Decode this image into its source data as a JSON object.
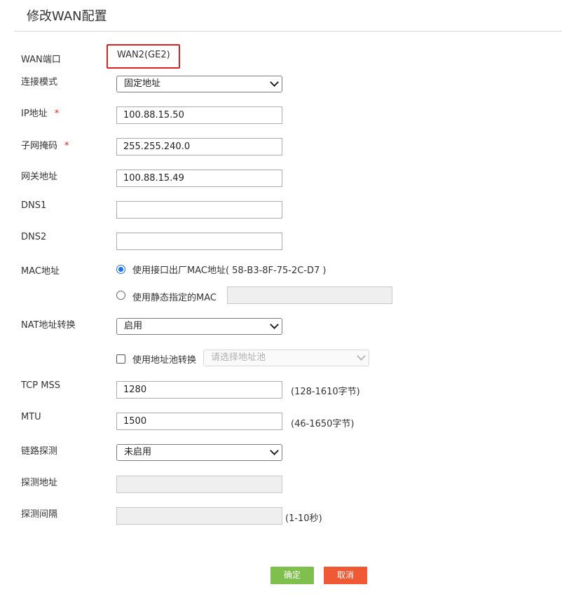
{
  "page": {
    "title": "修改WAN配置"
  },
  "wan_port": {
    "label": "WAN端口",
    "value": "WAN2(GE2)"
  },
  "connect_mode": {
    "label": "连接模式",
    "value": "固定地址"
  },
  "ip": {
    "label": "IP地址",
    "required": "*",
    "value": "100.88.15.50"
  },
  "mask": {
    "label": "子网掩码",
    "required": "*",
    "value": "255.255.240.0"
  },
  "gateway": {
    "label": "网关地址",
    "value": "100.88.15.49"
  },
  "dns1": {
    "label": "DNS1",
    "value": ""
  },
  "dns2": {
    "label": "DNS2",
    "value": ""
  },
  "mac": {
    "label": "MAC地址",
    "option_iface": "使用接口出厂MAC地址( 58-B3-8F-75-2C-D7 )",
    "option_static": "使用静态指定的MAC",
    "selected": "option_iface",
    "static_value": ""
  },
  "nat": {
    "label": "NAT地址转换",
    "value": "启用",
    "pool_checkbox_label": "使用地址池转换",
    "pool_checked": false,
    "pool_placeholder": "请选择地址池"
  },
  "tcp_mss": {
    "label": "TCP MSS",
    "value": "1280",
    "hint": "(128-1610字节)"
  },
  "mtu": {
    "label": "MTU",
    "value": "1500",
    "hint": "(46-1650字节)"
  },
  "link_detect": {
    "label": "链路探测",
    "value": "未启用"
  },
  "detect_addr": {
    "label": "探测地址",
    "value": ""
  },
  "detect_interval": {
    "label": "探测间隔",
    "value": "",
    "hint": "(1-10秒)"
  },
  "actions": {
    "ok_label": "确定",
    "cancel_label": "取消"
  },
  "colors": {
    "required": "#e02020",
    "highlight_box": "#e02020",
    "ok_button": "#7fbf4d",
    "cancel_button": "#ef5a34",
    "radio_checked": "#1a73e8"
  }
}
